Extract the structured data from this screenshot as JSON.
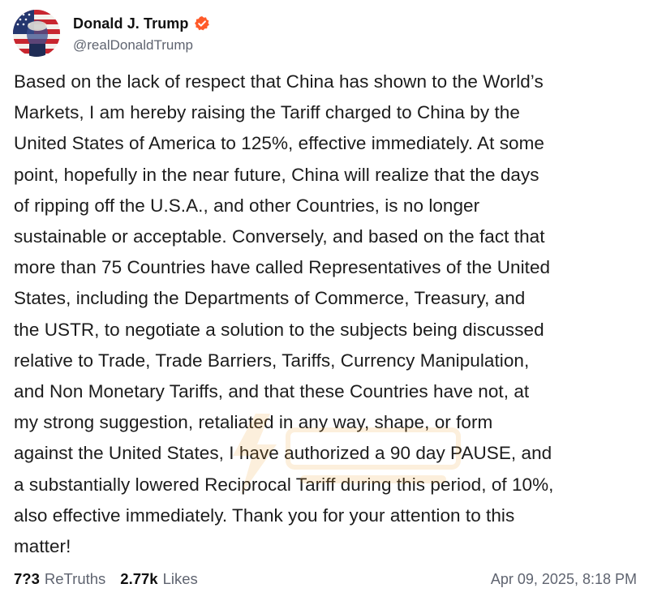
{
  "author": {
    "display_name": "Donald J. Trump",
    "handle": "@realDonaldTrump",
    "avatar_icon": "flag-portrait-avatar",
    "verified_icon": "verified-badge-icon",
    "verified_color": "#ff5a29"
  },
  "post": {
    "text": "Based on the lack of respect that China has shown to the World’s\nMarkets, I am hereby raising the Tariff charged to China by the\nUnited States of America to 125%, effective immediately. At some\npoint, hopefully in the near future, China will realize that the days\nof ripping off the U.S.A., and other Countries, is no longer\nsustainable or acceptable. Conversely, and based on the fact that\nmore than 75 Countries have called Representatives of the United\nStates, including the Departments of Commerce, Treasury, and\nthe USTR, to negotiate a solution to the subjects being discussed\nrelative to Trade, Trade Barriers, Tariffs, Currency Manipulation,\nand Non Monetary Tariffs, and that these Countries have not, at\nmy strong suggestion, retaliated in any way, shape, or form\nagainst the United States, I have authorized a 90 day PAUSE, and\na substantially lowered Reciprocal Tariff during this period, of 10%,\nalso effective immediately. Thank you for your attention to this\nmatter!"
  },
  "stats": {
    "retruths_count": "7?3",
    "retruths_label": "ReTruths",
    "likes_count": "2.77k",
    "likes_label": "Likes",
    "timestamp": "Apr 09, 2025, 8:18 PM"
  },
  "colors": {
    "text": "#1c1c1c",
    "muted": "#5f6470",
    "watermark": "#f2a22a"
  }
}
